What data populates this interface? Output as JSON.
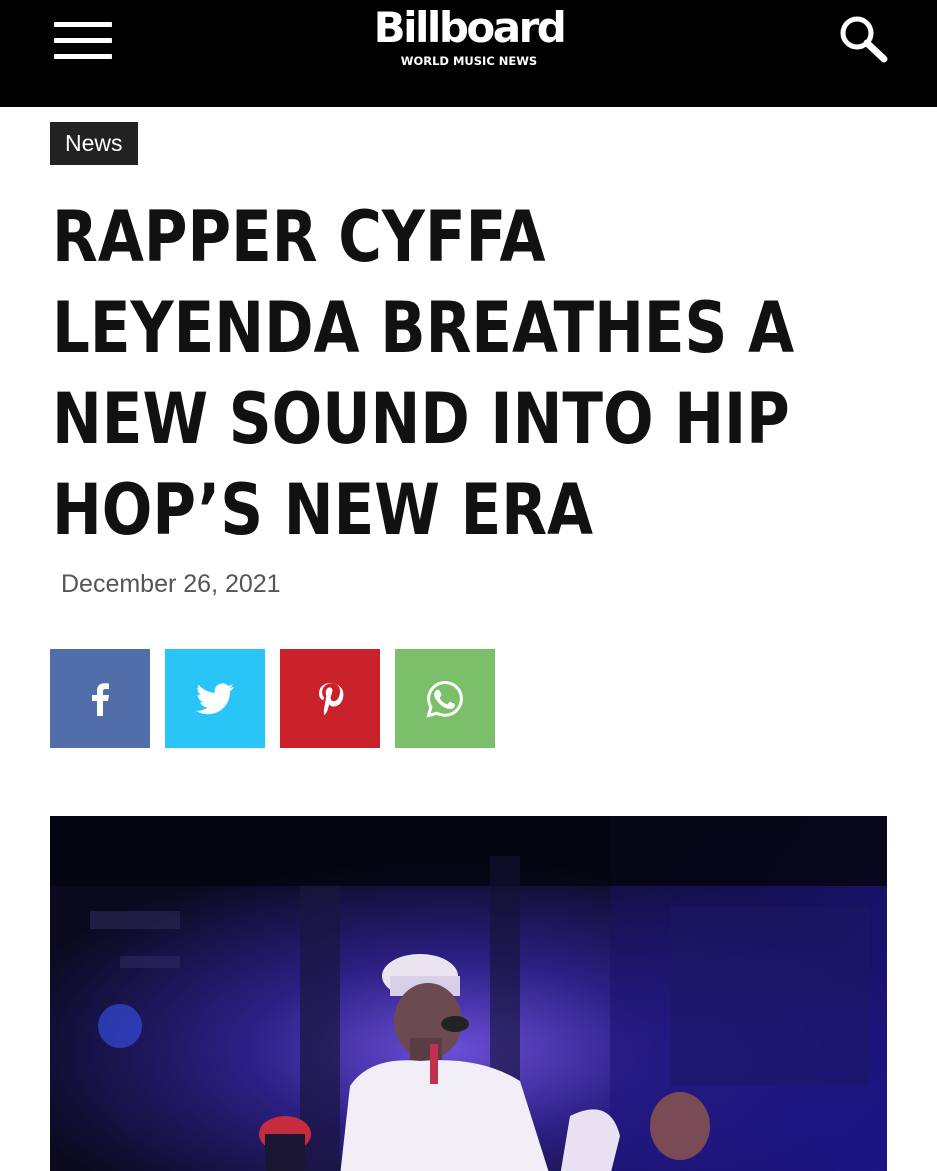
{
  "header": {
    "brand": "Billboard",
    "tagline": "WORLD MUSIC NEWS",
    "menu_icon": "hamburger-menu-icon",
    "search_icon": "search-icon"
  },
  "article": {
    "category": "News",
    "headline_lines": [
      "RAPPER CYFFA",
      "LEYENDA BREATHES A",
      "NEW SOUND INTO HIP",
      "HOP’S NEW ERA"
    ],
    "date": "December 26, 2021"
  },
  "share_buttons": [
    {
      "network": "facebook",
      "icon": "facebook-icon",
      "color": "#516eab"
    },
    {
      "network": "twitter",
      "icon": "twitter-icon",
      "color": "#29c5f6"
    },
    {
      "network": "pinterest",
      "icon": "pinterest-icon",
      "color": "#ca212a"
    },
    {
      "network": "whatsapp",
      "icon": "whatsapp-icon",
      "color": "#7bbf6a"
    }
  ],
  "colors": {
    "header_bg": "#000000",
    "category_bg": "#222222",
    "headline": "#111111"
  }
}
